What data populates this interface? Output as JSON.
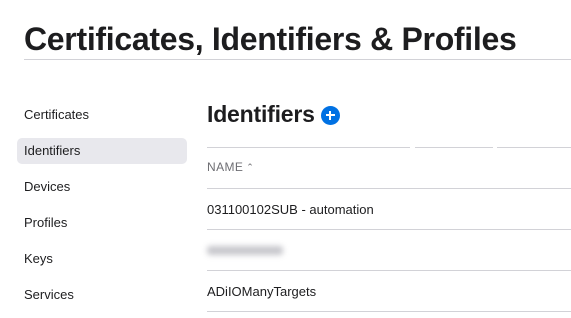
{
  "page": {
    "title": "Certificates, Identifiers & Profiles"
  },
  "sidebar": {
    "items": [
      {
        "label": "Certificates",
        "active": false
      },
      {
        "label": "Identifiers",
        "active": true
      },
      {
        "label": "Devices",
        "active": false
      },
      {
        "label": "Profiles",
        "active": false
      },
      {
        "label": "Keys",
        "active": false
      },
      {
        "label": "Services",
        "active": false
      }
    ]
  },
  "main": {
    "title": "Identifiers",
    "add_icon": "plus-circle-icon",
    "table": {
      "columns": [
        {
          "label": "NAME",
          "sort": "ascending",
          "sort_icon": "chevron-up-icon"
        }
      ],
      "rows": [
        {
          "name": "031100102SUB - automation",
          "obscured": false
        },
        {
          "name": "",
          "obscured": true
        },
        {
          "name": "ADiIOManyTargets",
          "obscured": false
        }
      ]
    }
  },
  "colors": {
    "accent": "#0071e3",
    "active_bg": "#e8e8ed",
    "divider": "#d2d2d7",
    "text": "#1d1d1f",
    "muted": "#6e6e73"
  }
}
